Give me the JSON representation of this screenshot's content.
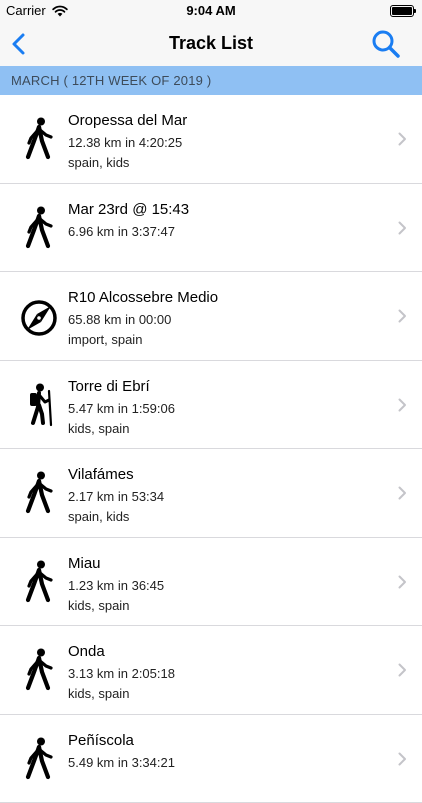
{
  "status_bar": {
    "carrier": "Carrier",
    "time": "9:04 AM",
    "wifi_icon": "wifi-icon",
    "battery_icon": "battery-icon"
  },
  "nav": {
    "title": "Track List",
    "back_icon": "chevron-left-icon",
    "search_icon": "search-icon",
    "accent_color": "#1a7df2"
  },
  "section": {
    "header": "MARCH ( 12TH WEEK OF 2019 )",
    "header_color": "#8fc0f3"
  },
  "tracks": [
    {
      "name": "Oropessa del Mar",
      "distance_time": "12.38 km in 4:20:25",
      "tags": "spain, kids",
      "icon": "walking-icon"
    },
    {
      "name": "Mar 23rd @ 15:43",
      "distance_time": "6.96 km in 3:37:47",
      "tags": "",
      "icon": "walking-icon"
    },
    {
      "name": "R10 Alcossebre Medio",
      "distance_time": "65.88 km in 00:00",
      "tags": "import, spain",
      "icon": "compass-icon"
    },
    {
      "name": "Torre di Ebrí",
      "distance_time": "5.47 km in 1:59:06",
      "tags": "kids, spain",
      "icon": "hiking-icon"
    },
    {
      "name": "Vilafámes",
      "distance_time": "2.17 km in 53:34",
      "tags": "spain, kids",
      "icon": "walking-icon"
    },
    {
      "name": "Miau",
      "distance_time": "1.23 km in 36:45",
      "tags": "kids, spain",
      "icon": "walking-icon"
    },
    {
      "name": "Onda",
      "distance_time": "3.13 km in 2:05:18",
      "tags": "kids, spain",
      "icon": "walking-icon"
    },
    {
      "name": "Peñíscola",
      "distance_time": "5.49 km in 3:34:21",
      "tags": "",
      "icon": "walking-icon"
    }
  ]
}
